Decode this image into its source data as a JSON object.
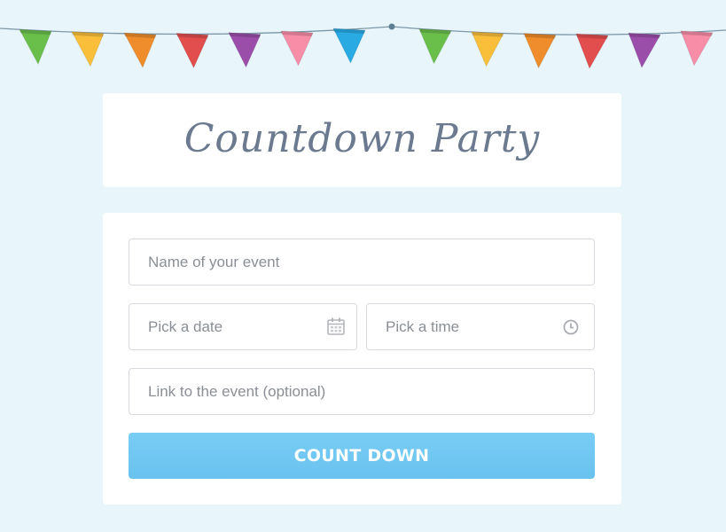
{
  "header": {
    "title": "Countdown Party"
  },
  "form": {
    "name_placeholder": "Name of your event",
    "date_placeholder": "Pick a date",
    "time_placeholder": "Pick a time",
    "link_placeholder": "Link to the event (optional)",
    "submit_label": "COUNT DOWN",
    "date_icon": "calendar-icon",
    "time_icon": "clock-icon"
  },
  "decoration": {
    "flag_colors": [
      "#6abf4b",
      "#f9bf3b",
      "#ef8c2b",
      "#e24e4e",
      "#9b4ea9",
      "#f78da7",
      "#29aae2"
    ],
    "string_color": "#7d97a8"
  },
  "colors": {
    "background": "#e8f6fc",
    "title": "#6b7a8f",
    "button": "#72c8f2"
  }
}
